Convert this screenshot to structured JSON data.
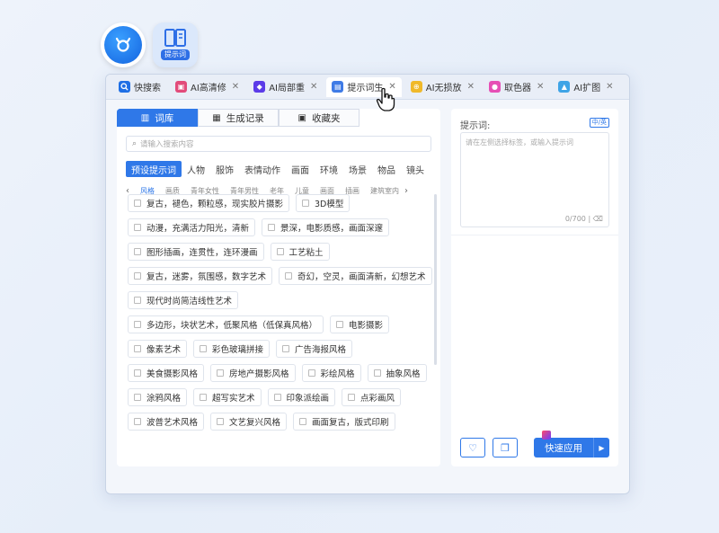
{
  "launcher": {
    "book_tag": "提示词"
  },
  "tabs": [
    {
      "label": "快搜索",
      "icon": "search-app-icon",
      "color": "#1f6fe5",
      "closable": false,
      "active": false
    },
    {
      "label": "AI高清修",
      "icon": "hd-repair-icon",
      "color": "#e24b7a",
      "closable": true,
      "active": false
    },
    {
      "label": "AI局部重",
      "icon": "partial-redraw-icon",
      "color": "#5b3be8",
      "closable": true,
      "active": false
    },
    {
      "label": "提示词生",
      "icon": "prompt-book-icon",
      "color": "#3f7be6",
      "closable": true,
      "active": true
    },
    {
      "label": "AI无损放",
      "icon": "lossless-zoom-icon",
      "color": "#f0b92a",
      "closable": true,
      "active": false
    },
    {
      "label": "取色器",
      "icon": "color-picker-icon",
      "color": "#e64fb5",
      "closable": true,
      "active": false
    },
    {
      "label": "AI扩图",
      "icon": "expand-image-icon",
      "color": "#3fa4e6",
      "closable": true,
      "active": false
    }
  ],
  "segments": [
    {
      "label": "词库",
      "active": true
    },
    {
      "label": "生成记录",
      "active": false
    },
    {
      "label": "收藏夹",
      "active": false
    }
  ],
  "search": {
    "placeholder": "请输入搜索内容"
  },
  "categories": [
    "预设提示词",
    "人物",
    "服饰",
    "表情动作",
    "画面",
    "环境",
    "场景",
    "物品",
    "镜头"
  ],
  "subcategories": [
    "风格",
    "画质",
    "青年女性",
    "青年男性",
    "老年",
    "儿童",
    "画面",
    "插画",
    "建筑室内"
  ],
  "chips": [
    "复古，褪色，颗粒感，现实胶片摄影",
    "3D模型",
    "动漫，充满活力阳光，清新",
    "景深，电影质感，画面深邃",
    "图形插画，连贯性，连环漫画",
    "工艺粘土",
    "复古，迷雾，氛围感，数字艺术",
    "奇幻，空灵，画面清新，幻想艺术",
    "现代时尚简洁线性艺术",
    "多边形，块状艺术，低聚风格（低保真风格）",
    "电影摄影",
    "像素艺术",
    "彩色玻璃拼接",
    "广告海报风格",
    "美食摄影风格",
    "房地产摄影风格",
    "彩绘风格",
    "抽象风格",
    "涂鸦风格",
    "超写实艺术",
    "印象派绘画",
    "点彩画风",
    "波普艺术风格",
    "文艺复兴风格",
    "画面复古，版式印刷"
  ],
  "prompt_panel": {
    "label": "提示词:",
    "toggle": "中/英",
    "placeholder": "请在左侧选择标签，或输入提示词",
    "count": "0/700",
    "apply": "快速应用"
  }
}
